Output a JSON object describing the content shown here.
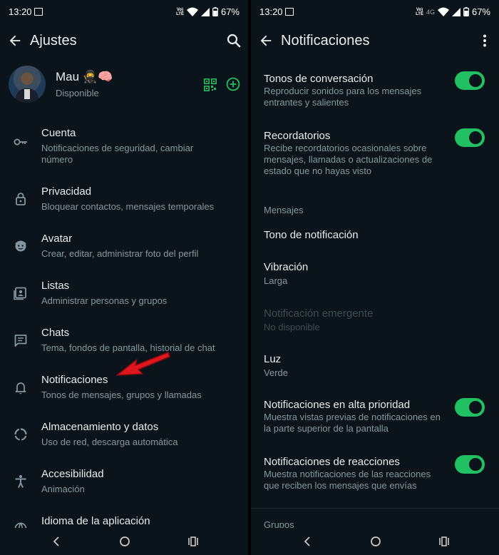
{
  "status_bar": {
    "time": "13:20",
    "signal_tags": [
      "Vo)",
      "LTE"
    ],
    "network": "4G",
    "battery": "67%"
  },
  "colors": {
    "background": "#0b141a",
    "accent": "#21c063",
    "arrow": "#e0161e"
  },
  "settings_screen": {
    "title": "Ajustes",
    "profile": {
      "name": "Mau 🥷🧠",
      "status": "Disponible"
    },
    "items": [
      {
        "label": "Cuenta",
        "description": "Notificaciones de seguridad, cambiar número",
        "icon": "key-icon"
      },
      {
        "label": "Privacidad",
        "description": "Bloquear contactos, mensajes temporales",
        "icon": "lock-icon"
      },
      {
        "label": "Avatar",
        "description": "Crear, editar, administrar foto del perfil",
        "icon": "avatar-face-icon"
      },
      {
        "label": "Listas",
        "description": "Administrar personas y grupos",
        "icon": "contact-list-icon"
      },
      {
        "label": "Chats",
        "description": "Tema, fondos de pantalla, historial de chat",
        "icon": "chat-icon"
      },
      {
        "label": "Notificaciones",
        "description": "Tonos de mensajes, grupos y llamadas",
        "icon": "bell-icon"
      },
      {
        "label": "Almacenamiento y datos",
        "description": "Uso de red, descarga automática",
        "icon": "storage-icon"
      },
      {
        "label": "Accesibilidad",
        "description": "Animación",
        "icon": "accessibility-icon"
      },
      {
        "label": "Idioma de la aplicación",
        "description": "",
        "icon": "globe-icon"
      }
    ]
  },
  "notifications_screen": {
    "title": "Notificaciones",
    "tonos": {
      "title": "Tonos de conversación",
      "description": "Reproducir sonidos para los mensajes entrantes y salientes",
      "enabled": true
    },
    "recordatorios": {
      "title": "Recordatorios",
      "description": "Recibe recordatorios ocasionales sobre mensajes, llamadas o actualizaciones de estado que no hayas visto",
      "enabled": true
    },
    "mensajes_section": "Mensajes",
    "tono_notificacion": {
      "title": "Tono de notificación"
    },
    "vibracion": {
      "title": "Vibración",
      "value": "Larga"
    },
    "emergente": {
      "title": "Notificación emergente",
      "value": "No disponible"
    },
    "luz": {
      "title": "Luz",
      "value": "Verde"
    },
    "alta_prioridad": {
      "title": "Notificaciones en alta prioridad",
      "description": "Muestra vistas previas de notificaciones en la parte superior de la pantalla",
      "enabled": true
    },
    "reacciones": {
      "title": "Notificaciones de reacciones",
      "description": "Muestra notificaciones de las reacciones que reciben los mensajes que envías",
      "enabled": true
    },
    "grupos_section": "Grupos"
  }
}
